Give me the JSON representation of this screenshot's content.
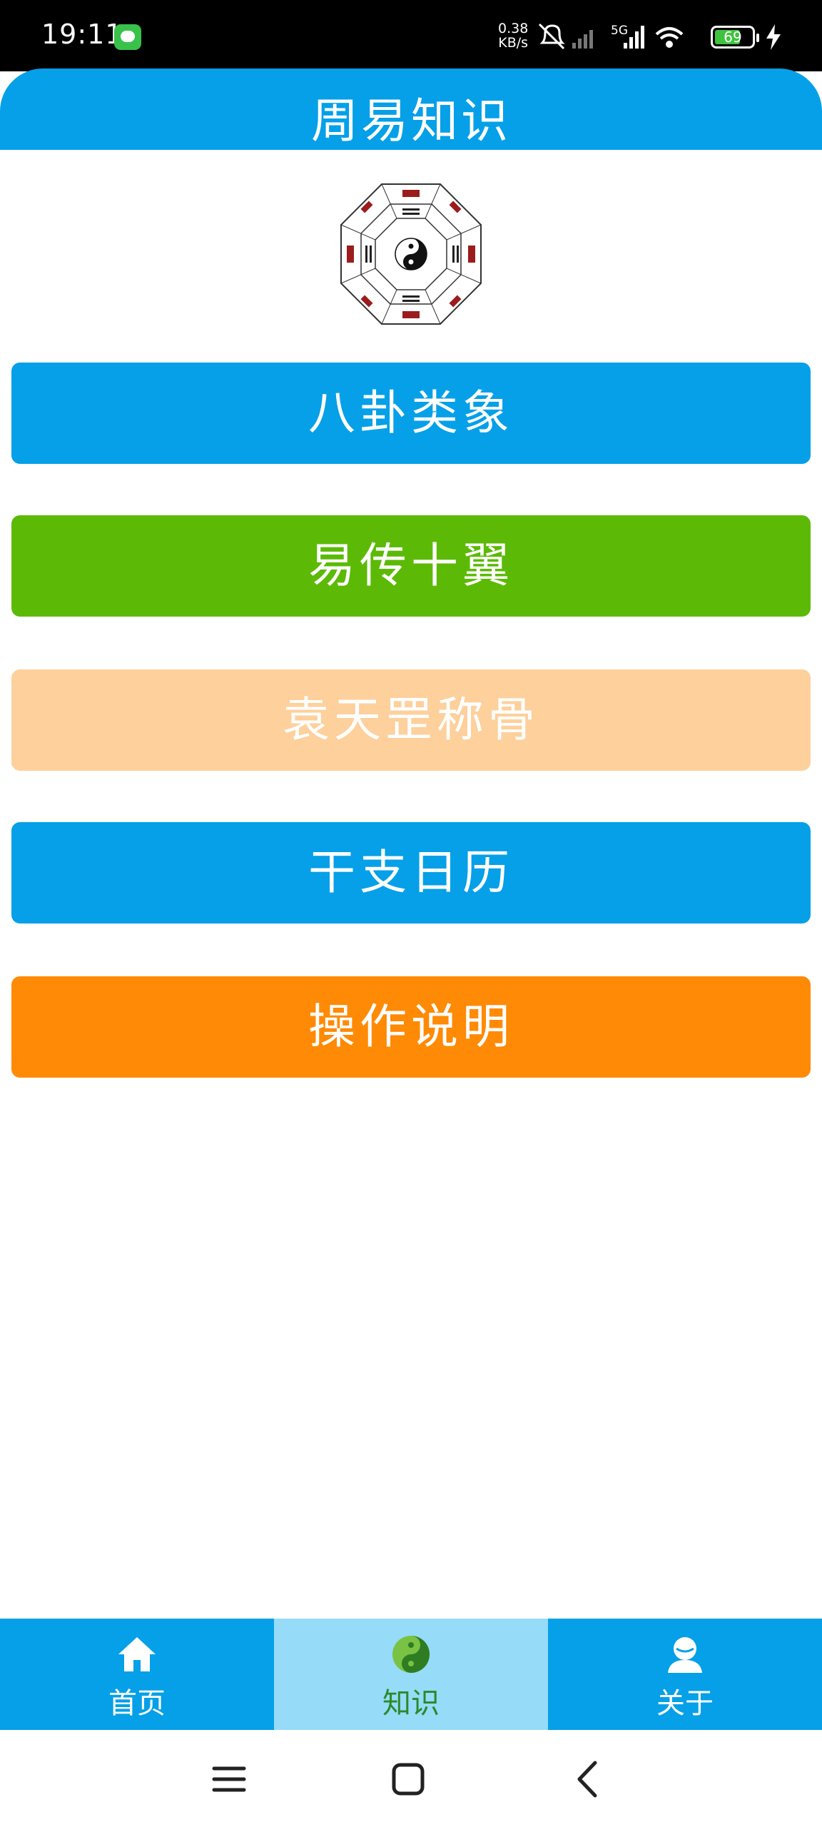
{
  "status_bar": {
    "time": "19:11",
    "net_speed_value": "0.38",
    "net_speed_unit": "KB/s",
    "network_type": "5G",
    "battery_level": "69"
  },
  "header": {
    "title": "周易知识"
  },
  "menu": [
    {
      "label": "八卦类象",
      "color": "#05a0e8"
    },
    {
      "label": "易传十翼",
      "color": "#5cba06"
    },
    {
      "label": "袁天罡称骨",
      "color": "#fdd09c"
    },
    {
      "label": "干支日历",
      "color": "#05a0e8"
    },
    {
      "label": "操作说明",
      "color": "#ff8a05"
    }
  ],
  "tabs": [
    {
      "label": "首页",
      "icon": "home-icon"
    },
    {
      "label": "知识",
      "icon": "yin-yang-icon"
    },
    {
      "label": "关于",
      "icon": "person-icon"
    }
  ],
  "nav": {
    "icons": [
      "menu-icon",
      "home-square-icon",
      "back-icon"
    ]
  }
}
